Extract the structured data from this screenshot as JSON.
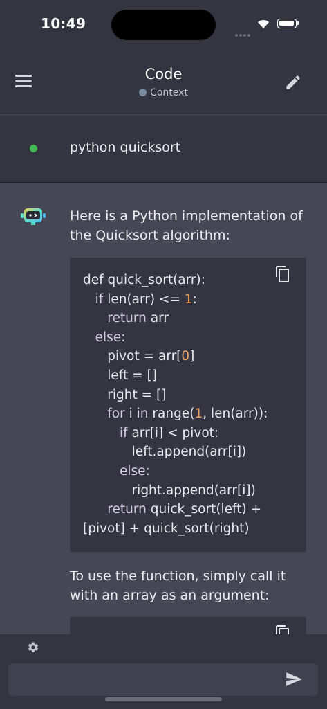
{
  "status_bar": {
    "time": "10:49"
  },
  "app_bar": {
    "title": "Code",
    "context_label": "Context"
  },
  "user_message": {
    "text": "python quicksort"
  },
  "assistant": {
    "intro": "Here is a Python implementation of the Quicksort algorithm:",
    "code_lines": [
      [
        {
          "t": "def quick_sort(arr):"
        }
      ],
      [
        {
          "t": "   "
        },
        {
          "t": "if",
          "c": "kw"
        },
        {
          "t": " len(arr) <= "
        },
        {
          "t": "1",
          "c": "num"
        },
        {
          "t": ":"
        }
      ],
      [
        {
          "t": "      "
        },
        {
          "t": "return",
          "c": "kw"
        },
        {
          "t": " arr"
        }
      ],
      [
        {
          "t": "   "
        },
        {
          "t": "else",
          "c": "kw"
        },
        {
          "t": ":"
        }
      ],
      [
        {
          "t": "      pivot = arr["
        },
        {
          "t": "0",
          "c": "num"
        },
        {
          "t": "]"
        }
      ],
      [
        {
          "t": "      left = []"
        }
      ],
      [
        {
          "t": "      right = []"
        }
      ],
      [
        {
          "t": "      "
        },
        {
          "t": "for",
          "c": "kw"
        },
        {
          "t": " i "
        },
        {
          "t": "in",
          "c": "kw"
        },
        {
          "t": " range("
        },
        {
          "t": "1",
          "c": "num"
        },
        {
          "t": ", len(arr)):"
        }
      ],
      [
        {
          "t": "         "
        },
        {
          "t": "if",
          "c": "kw"
        },
        {
          "t": " arr[i] < pivot:"
        }
      ],
      [
        {
          "t": "            left.append(arr[i])"
        }
      ],
      [
        {
          "t": "         "
        },
        {
          "t": "else",
          "c": "kw"
        },
        {
          "t": ":"
        }
      ],
      [
        {
          "t": "            right.append(arr[i])"
        }
      ],
      [
        {
          "t": "      "
        },
        {
          "t": "return",
          "c": "kw"
        },
        {
          "t": " quick_sort(left) +"
        }
      ],
      [
        {
          "t": "[pivot] + quick_sort(right)"
        }
      ]
    ],
    "followup": "To use the function, simply call it with an array as an argument:"
  },
  "input": {
    "placeholder": ""
  },
  "colors": {
    "background": "#454754",
    "bar": "#343541",
    "status_dot": "#3fb950",
    "context_dot": "#7b8da3",
    "number_highlight": "#f0a35e"
  },
  "icons": [
    "menu-icon",
    "pencil-icon",
    "bot-icon",
    "copy-icon",
    "settings-icon",
    "send-icon"
  ]
}
